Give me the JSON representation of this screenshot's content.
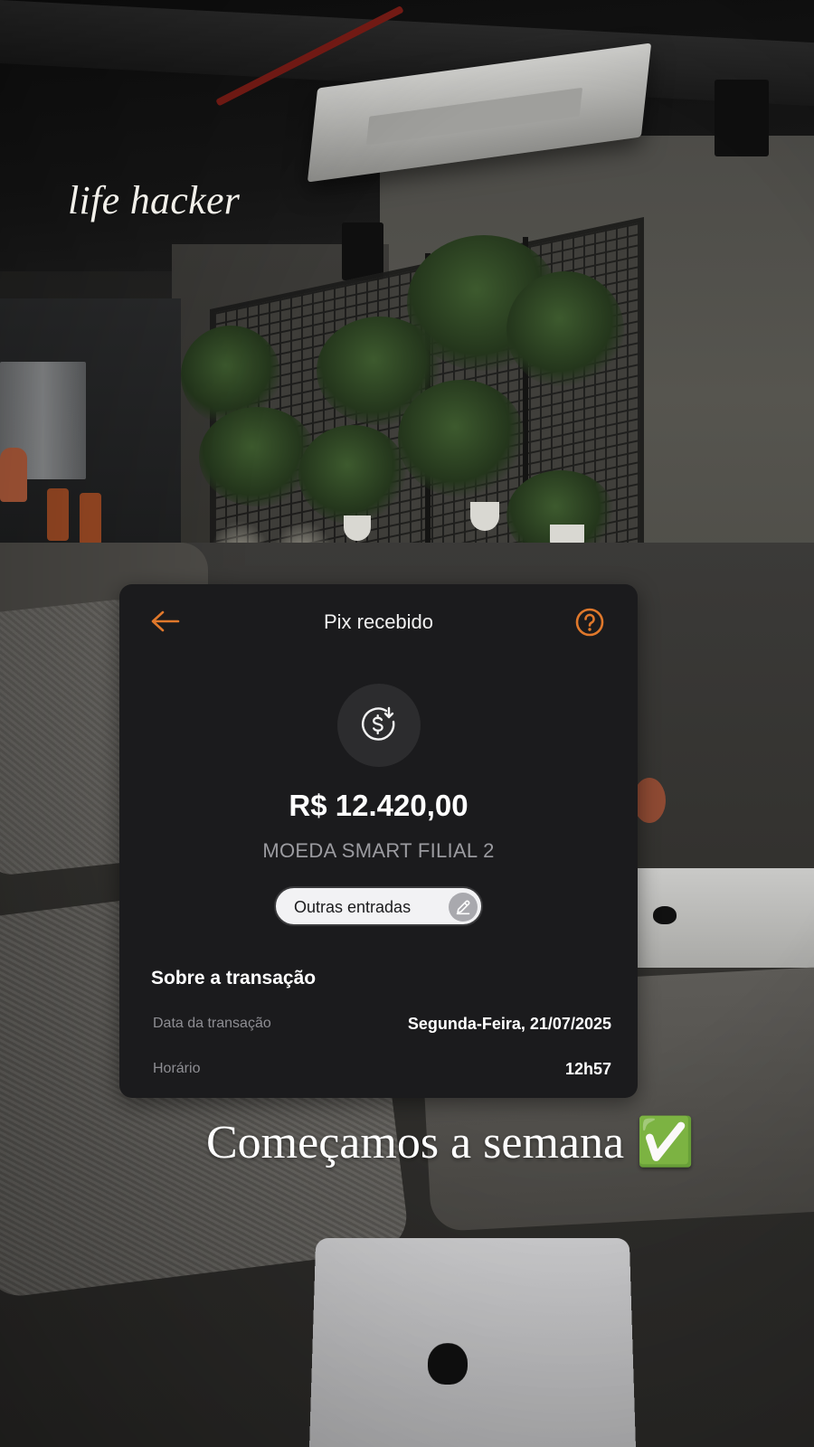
{
  "overlay": {
    "brand": "life hacker",
    "caption": "Começamos a semana ✅"
  },
  "receipt": {
    "title": "Pix recebido",
    "back_icon": "arrow-left-icon",
    "help_icon": "question-circle-icon",
    "transaction_icon": "money-receive-icon",
    "amount": "R$ 12.420,00",
    "payer": "MOEDA SMART FILIAL 2",
    "category_chip": "Outras entradas",
    "chip_icon": "pencil-icon",
    "section_title": "Sobre a transação",
    "rows": [
      {
        "label": "Data da transação",
        "value": "Segunda-Feira, 21/07/2025"
      },
      {
        "label": "Horário",
        "value": "12h57"
      }
    ],
    "accent_color": "#e0782b"
  }
}
